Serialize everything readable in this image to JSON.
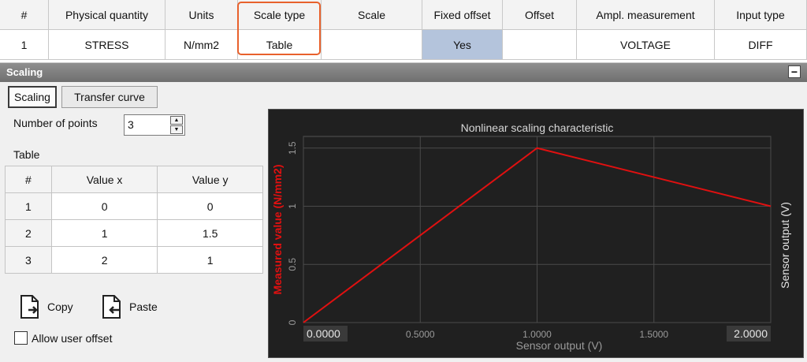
{
  "top_table": {
    "columns": [
      {
        "key": "index",
        "label": "#",
        "width": 62
      },
      {
        "key": "physical_quantity",
        "label": "Physical quantity",
        "width": 148
      },
      {
        "key": "units",
        "label": "Units",
        "width": 92
      },
      {
        "key": "scale_type",
        "label": "Scale type",
        "width": 106
      },
      {
        "key": "scale",
        "label": "Scale",
        "width": 128
      },
      {
        "key": "fixed_offset",
        "label": "Fixed offset",
        "width": 102
      },
      {
        "key": "offset",
        "label": "Offset",
        "width": 94
      },
      {
        "key": "ampl_measurement",
        "label": "Ampl. measurement",
        "width": 175
      },
      {
        "key": "input_type",
        "label": "Input type",
        "width": 117
      }
    ],
    "row": {
      "index": "1",
      "physical_quantity": "STRESS",
      "units": "N/mm2",
      "scale_type": "Table",
      "scale": "",
      "fixed_offset": "Yes",
      "offset": "",
      "ampl_measurement": "VOLTAGE",
      "input_type": "DIFF"
    },
    "highlight_color": "#e8612c"
  },
  "scaling_panel": {
    "title": "Scaling",
    "collapse_symbol": "−",
    "tabs": [
      {
        "label": "Scaling",
        "active": true
      },
      {
        "label": "Transfer curve",
        "active": false
      }
    ],
    "number_of_points_label": "Number of points",
    "number_of_points_value": "3",
    "table_label": "Table",
    "table_headers": [
      "#",
      "Value x",
      "Value y"
    ],
    "table_rows": [
      [
        "1",
        "0",
        "0"
      ],
      [
        "2",
        "1",
        "1.5"
      ],
      [
        "3",
        "2",
        "1"
      ]
    ],
    "copy_label": "Copy",
    "paste_label": "Paste",
    "allow_user_offset_label": "Allow user offset",
    "allow_user_offset_checked": false
  },
  "chart_data": {
    "type": "line",
    "title": "Nonlinear scaling characteristic",
    "xlabel": "Sensor output (V)",
    "ylabel": "Measured value (N/mm2)",
    "y2label": "Sensor output (V)",
    "xlim": [
      0,
      2
    ],
    "ylim": [
      0,
      1.6
    ],
    "x_ticks": [
      0,
      0.5,
      1,
      1.5,
      2
    ],
    "x_tick_labels": [
      "0.0000",
      "0.5000",
      "1.0000",
      "1.5000",
      "2.0000"
    ],
    "y_ticks": [
      0,
      0.5,
      1,
      1.5
    ],
    "y_tick_labels": [
      "0",
      "0.5",
      "1",
      "1.5"
    ],
    "grid": true,
    "series": [
      {
        "x": [
          0,
          1,
          2
        ],
        "y": [
          0,
          1.5,
          1
        ],
        "color": "#e01010"
      }
    ],
    "colors": {
      "background": "#202020",
      "grid": "#4a4a4a",
      "axis_text": "#9a9a9a",
      "title": "#d8d8d8",
      "ylabel": "#e01010"
    }
  }
}
